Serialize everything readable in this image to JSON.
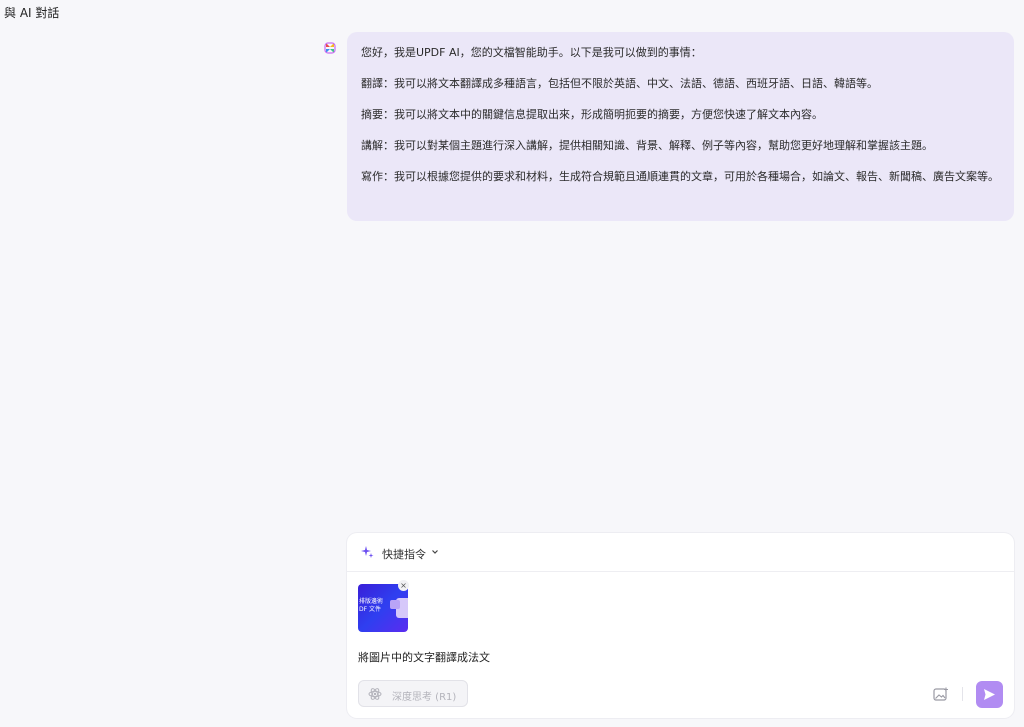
{
  "header": {
    "title": "與 AI 對話"
  },
  "message": {
    "paragraphs": [
      "您好，我是UPDF AI，您的文檔智能助手。以下是我可以做到的事情：",
      "翻譯：我可以將文本翻譯成多種語言，包括但不限於英語、中文、法語、德語、西班牙語、日語、韓語等。",
      "摘要：我可以將文本中的關鍵信息提取出來，形成簡明扼要的摘要，方便您快速了解文本內容。",
      "講解：我可以對某個主題進行深入講解，提供相關知識、背景、解釋、例子等內容，幫助您更好地理解和掌握該主題。",
      "寫作：我可以根據您提供的要求和材料，生成符合規範且通順連貫的文章，可用於各種場合，如論文、報告、新聞稿、廣告文案等。"
    ]
  },
  "composer": {
    "quick_commands_label": "快捷指令",
    "attachment_thumb_text": "排版邊術\nDF 文件",
    "attachment_close": "×",
    "prompt_text": "將圖片中的文字翻譯成法文",
    "deep_think_label": "深度思考 (R1)"
  },
  "colors": {
    "bubble": "#ebe7f8",
    "send": "#b18cf2",
    "accent": "#6b4ef0"
  }
}
